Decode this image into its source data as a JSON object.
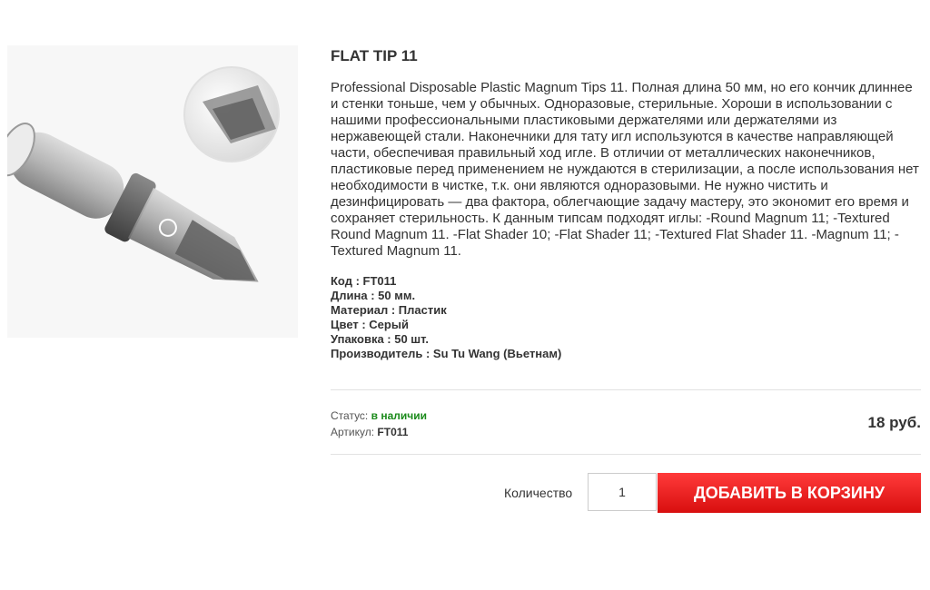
{
  "product": {
    "title": "FLAT TIP 11",
    "description": "Professional Disposable Plastic Magnum Tips 11. Полная длина 50 мм, но его кончик длиннее и стенки тоньше, чем у обычных. Одноразовые, стерильные. Хороши в использовании с нашими профессиональными пластиковыми держателями или держателями из нержавеющей стали. Наконечники для тату игл используются в качестве направляющей части, обеспечивая правильный ход игле. В отличии от металлических наконечников, пластиковые перед применением не нуждаются в стерилизации, а после использования нет необходимости в чистке, т.к. они являются одноразовыми. Не нужно чистить и дезинфицировать — два фактора, облегчающие задачу мастеру, это экономит его время и сохраняет стерильность. К данным типсам подходят иглы: -Round Magnum 11; -Textured Round Magnum 11. -Flat Shader 10; -Flat Shader 11; -Textured Flat Shader 11. -Magnum 11; -Textured Magnum 11.",
    "specs": [
      "Код : FT011",
      "Длина : 50 мм.",
      "Материал : Пластик",
      "Цвет : Серый",
      "Упаковка : 50 шт.",
      "Производитель : Su Tu Wang (Вьетнам)"
    ]
  },
  "status": {
    "label": "Статус:",
    "value": "в наличии",
    "sku_label": "Артикул:",
    "sku_value": "FT011"
  },
  "price": "18 руб.",
  "cart": {
    "qty_label": "Количество",
    "qty_value": "1",
    "add_button": "ДОБАВИТЬ В КОРЗИНУ"
  },
  "colors": {
    "status_green": "#1a8a1a",
    "button_red": "#e31b1b"
  }
}
